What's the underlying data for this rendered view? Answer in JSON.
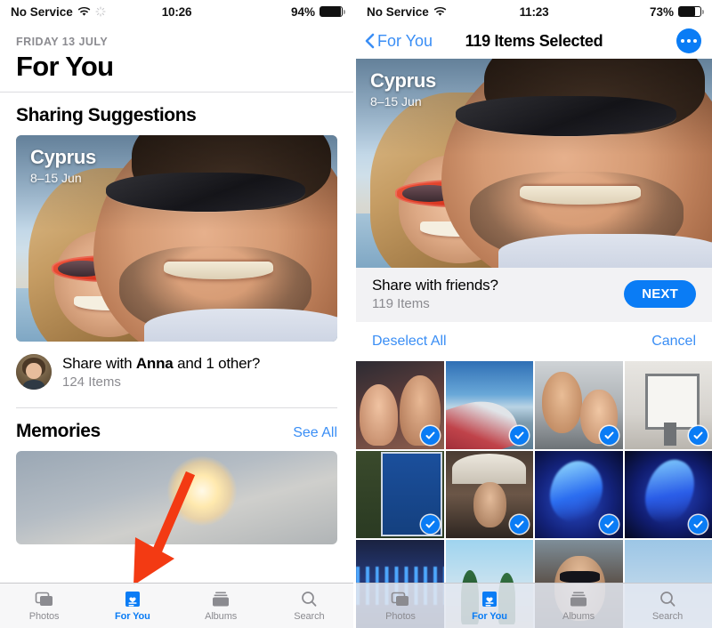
{
  "meta": {
    "accent_blue": "#0a7cf5",
    "link_blue": "#3a8ef5",
    "arrow_red": "#f33a13",
    "gray_text": "#8b8b90"
  },
  "left": {
    "status": {
      "carrier": "No Service",
      "time": "10:26",
      "battery": "94%",
      "battery_level": 94,
      "wifi_icon": "wifi-icon",
      "sync_icon": "sync-spinner-icon",
      "battery_icon": "battery-icon"
    },
    "header": {
      "date": "FRIDAY 13 JULY",
      "title": "For You"
    },
    "sharing_suggestions": {
      "section_title": "Sharing Suggestions",
      "card": {
        "title": "Cyprus",
        "subtitle": "8–15 Jun"
      },
      "share_line": "Share with Anna and 1 other?",
      "share_name": "Anna",
      "item_count": "124 Items",
      "avatar_name": "contact-avatar"
    },
    "memories": {
      "section_title": "Memories",
      "see_all": "See All"
    },
    "annotation": {
      "name": "red-arrow-pointer",
      "color": "#f33a13",
      "points_to": "For You"
    },
    "tabs": [
      {
        "label": "Photos",
        "icon": "photos-stack-icon",
        "active": false
      },
      {
        "label": "For You",
        "icon": "for-you-heart-card-icon",
        "active": true
      },
      {
        "label": "Albums",
        "icon": "albums-stack-icon",
        "active": false
      },
      {
        "label": "Search",
        "icon": "search-magnifier-icon",
        "active": false
      }
    ]
  },
  "right": {
    "status": {
      "carrier": "No Service",
      "time": "11:23",
      "battery": "73%",
      "battery_level": 73,
      "wifi_icon": "wifi-icon",
      "battery_icon": "battery-icon"
    },
    "navbar": {
      "back_label": "For You",
      "back_icon": "chevron-left-icon",
      "title": "119 Items Selected",
      "more_icon": "more-ellipsis-icon"
    },
    "hero": {
      "title": "Cyprus",
      "subtitle": "8–15 Jun"
    },
    "share_bar": {
      "prompt": "Share with friends?",
      "item_count": "119 Items",
      "next_label": "NEXT"
    },
    "action_bar": {
      "deselect_all": "Deselect All",
      "cancel": "Cancel"
    },
    "grid": {
      "selected_icon": "checkmark-circle-icon",
      "cells": [
        {
          "art": "a1",
          "alt": "couple-selfie-indoor",
          "selected": true
        },
        {
          "art": "a2",
          "alt": "airplane-wing-window",
          "selected": true
        },
        {
          "art": "a3",
          "alt": "couple-selfie-airport",
          "selected": true
        },
        {
          "art": "a4",
          "alt": "framed-sign-notice",
          "selected": true
        },
        {
          "art": "a5",
          "alt": "road-sign-pafos-timi",
          "selected": true
        },
        {
          "art": "a6",
          "alt": "woman-under-parasol",
          "selected": true
        },
        {
          "art": "a7",
          "alt": "blue-night-lights",
          "selected": true
        },
        {
          "art": "a8",
          "alt": "blue-night-lights-2",
          "selected": true
        },
        {
          "art": "a9",
          "alt": "blue-fountain-night",
          "selected": false
        },
        {
          "art": "a10",
          "alt": "pine-trees-blue-sky",
          "selected": false
        },
        {
          "art": "a11",
          "alt": "man-sunglasses-selfie",
          "selected": false
        },
        {
          "art": "a12",
          "alt": "pale-blue-sky",
          "selected": false
        }
      ]
    },
    "tabs": [
      {
        "label": "Photos",
        "icon": "photos-stack-icon",
        "active": false
      },
      {
        "label": "For You",
        "icon": "for-you-heart-card-icon",
        "active": true
      },
      {
        "label": "Albums",
        "icon": "albums-stack-icon",
        "active": false
      },
      {
        "label": "Search",
        "icon": "search-magnifier-icon",
        "active": false
      }
    ]
  }
}
